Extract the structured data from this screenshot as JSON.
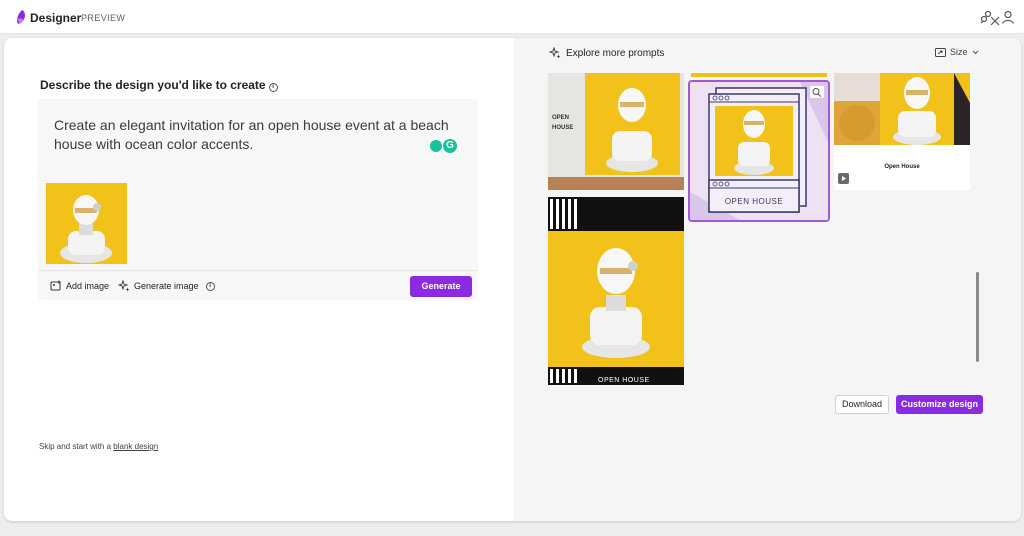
{
  "app": {
    "brand": "Designer",
    "badge": "PREVIEW"
  },
  "left": {
    "heading": "Describe the design you'd like to create",
    "prompt_text": "Create an elegant invitation for an open house event at a beach house with ocean color accents.",
    "add_image_label": "Add image",
    "generate_image_label": "Generate image",
    "generate_button": "Generate",
    "skip_text": "Skip and start with a",
    "skip_link": "blank design"
  },
  "right": {
    "explore_label": "Explore more prompts",
    "size_label": "Size",
    "download_button": "Download",
    "customize_button": "Customize design",
    "tiles": [
      {
        "label": "OPEN HOUSE"
      },
      {
        "label": "OPEN HOUSE"
      },
      {
        "label": "Open House"
      },
      {
        "label": "OPEN HOUSE"
      }
    ]
  },
  "colors": {
    "accent": "#8a2be2",
    "yellow": "#f2c21a",
    "selected_tile_border": "#a259d9"
  }
}
